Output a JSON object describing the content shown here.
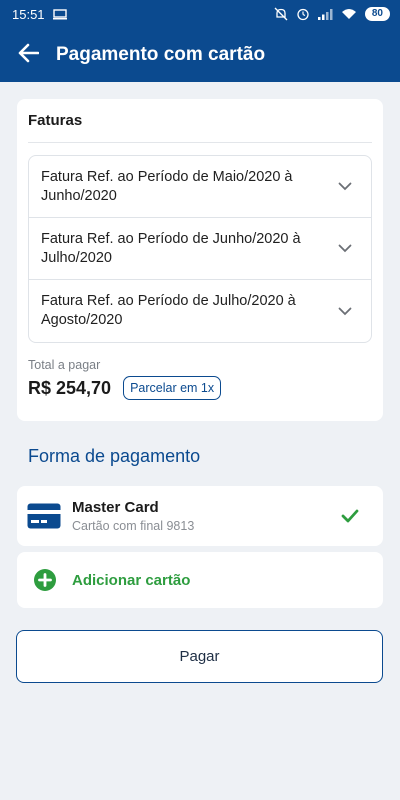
{
  "status_bar": {
    "time": "15:51",
    "battery": "80",
    "icons": [
      "screen-icon",
      "mute-icon",
      "alarm-icon",
      "signal-icon",
      "wifi-icon",
      "battery-icon"
    ]
  },
  "header": {
    "title": "Pagamento com cartão",
    "back_icon": "back-arrow-icon"
  },
  "invoices": {
    "heading": "Faturas",
    "items": [
      {
        "label": "Fatura Ref. ao Período de Maio/2020 à Junho/2020"
      },
      {
        "label": "Fatura Ref. ao Período de Junho/2020 à Julho/2020"
      },
      {
        "label": "Fatura Ref. ao Período de Julho/2020 à Agosto/2020"
      }
    ],
    "total_label": "Total a pagar",
    "total_value": "R$ 254,70",
    "installment_button": "Parcelar em 1x"
  },
  "payment": {
    "heading": "Forma de pagamento",
    "selected_card": {
      "name": "Master Card",
      "detail": "Cartão com final 9813"
    },
    "add_card_label": "Adicionar cartão",
    "pay_button": "Pagar"
  },
  "colors": {
    "primary": "#0b4a8f",
    "success": "#2e9d3f",
    "background": "#eef1f5"
  }
}
